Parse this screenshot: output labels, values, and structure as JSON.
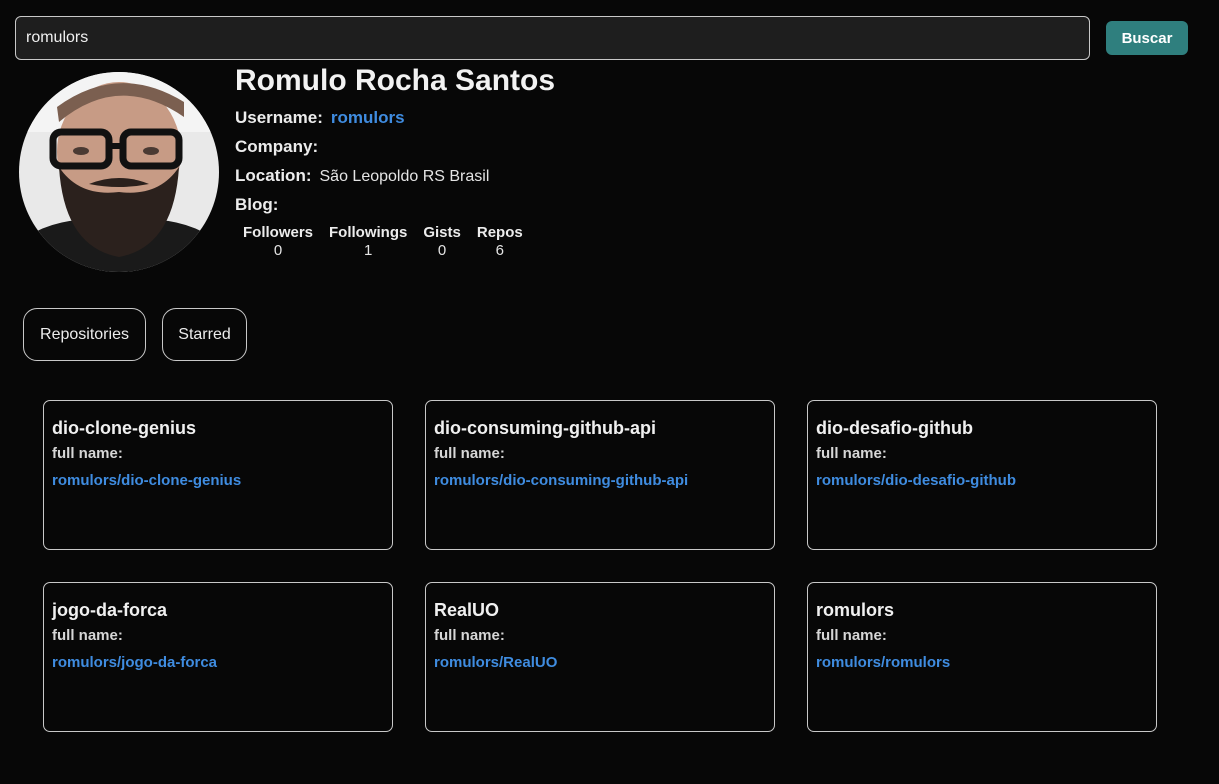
{
  "search": {
    "value": "romulors",
    "button_label": "Buscar"
  },
  "profile": {
    "name": "Romulo Rocha Santos",
    "username_label": "Username:",
    "username": "romulors",
    "company_label": "Company:",
    "company": "",
    "location_label": "Location:",
    "location": "São Leopoldo RS Brasil",
    "blog_label": "Blog:",
    "blog": "",
    "stats": [
      {
        "label": "Followers",
        "value": "0"
      },
      {
        "label": "Followings",
        "value": "1"
      },
      {
        "label": "Gists",
        "value": "0"
      },
      {
        "label": "Repos",
        "value": "6"
      }
    ]
  },
  "tabs": [
    {
      "label": "Repositories"
    },
    {
      "label": "Starred"
    }
  ],
  "repos": [
    {
      "name": "dio-clone-genius",
      "full_name_label": "full name:",
      "full_name": "romulors/dio-clone-genius"
    },
    {
      "name": "dio-consuming-github-api",
      "full_name_label": "full name:",
      "full_name": "romulors/dio-consuming-github-api"
    },
    {
      "name": "dio-desafio-github",
      "full_name_label": "full name:",
      "full_name": "romulors/dio-desafio-github"
    },
    {
      "name": "jogo-da-forca",
      "full_name_label": "full name:",
      "full_name": "romulors/jogo-da-forca"
    },
    {
      "name": "RealUO",
      "full_name_label": "full name:",
      "full_name": "romulors/RealUO"
    },
    {
      "name": "romulors",
      "full_name_label": "full name:",
      "full_name": "romulors/romulors"
    }
  ],
  "colors": {
    "background": "#070707",
    "accent_button": "#2f7f7e",
    "link": "#3f8ce0",
    "border": "#c8c8c8"
  }
}
